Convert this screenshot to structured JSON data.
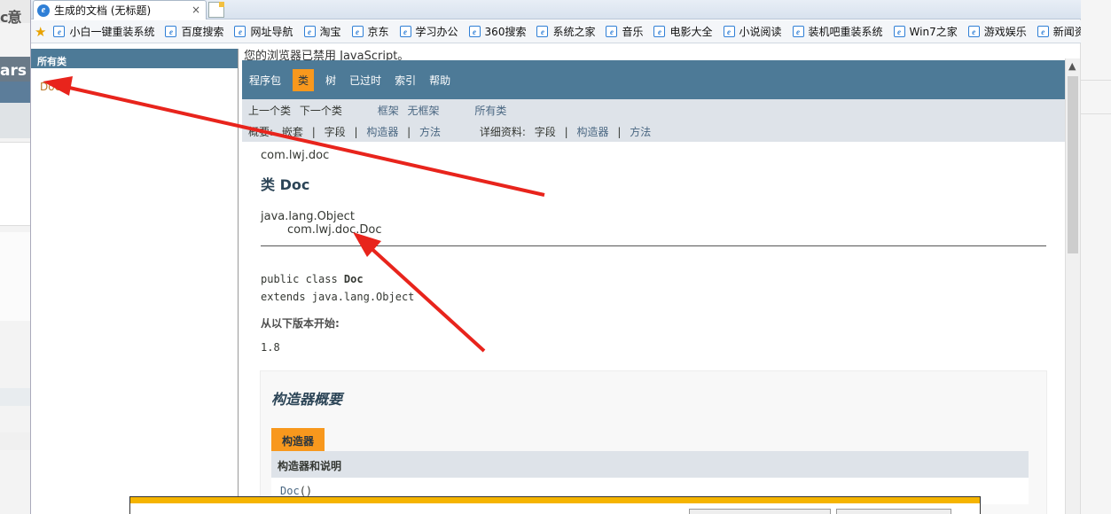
{
  "background_page": {
    "fragment_top": "c意",
    "fragment_mid": "ars"
  },
  "browser": {
    "tab_title": "生成的文档 (无标题)",
    "tab_close": "×",
    "favorites": [
      "小白一键重装系统",
      "百度搜索",
      "网址导航",
      "淘宝",
      "京东",
      "学习办公",
      "360搜索",
      "系统之家",
      "音乐",
      "电影大全",
      "小说阅读",
      "装机吧重装系统",
      "Win7之家",
      "游戏娱乐",
      "新闻资讯"
    ]
  },
  "left_frame": {
    "header": "所有类",
    "items": [
      "Doc"
    ]
  },
  "right_frame": {
    "nojs_notice": "您的浏览器已禁用 JavaScript。",
    "topnav": [
      "程序包",
      "类",
      "树",
      "已过时",
      "索引",
      "帮助"
    ],
    "topnav_active": "类",
    "subnav": {
      "prev_class": "上一个类",
      "next_class": "下一个类",
      "frames": "框架",
      "no_frames": "无框架",
      "all_classes": "所有类",
      "summary_label": "概要:",
      "nested": "嵌套",
      "sep": "|",
      "field": "字段",
      "constructor": "构造器",
      "method": "方法",
      "detail_label": "详细资料:"
    },
    "package": "com.lwj.doc",
    "class_title": "类 Doc",
    "inheritance": [
      "java.lang.Object",
      "com.lwj.doc.Doc"
    ],
    "signature_line1_prefix": "public class ",
    "signature_class": "Doc",
    "signature_line2": "extends java.lang.Object",
    "since_label": "从以下版本开始:",
    "since_value": "1.8",
    "constructor_summary": {
      "title": "构造器概要",
      "caption": "构造器",
      "header": "构造器和说明",
      "row_name": "Doc",
      "row_suffix": "()"
    }
  },
  "colors": {
    "nav_bg": "#4d7a97",
    "active_tab": "#f8981d",
    "subnav_bg": "#dee3e9",
    "arrow": "#e8241c"
  }
}
